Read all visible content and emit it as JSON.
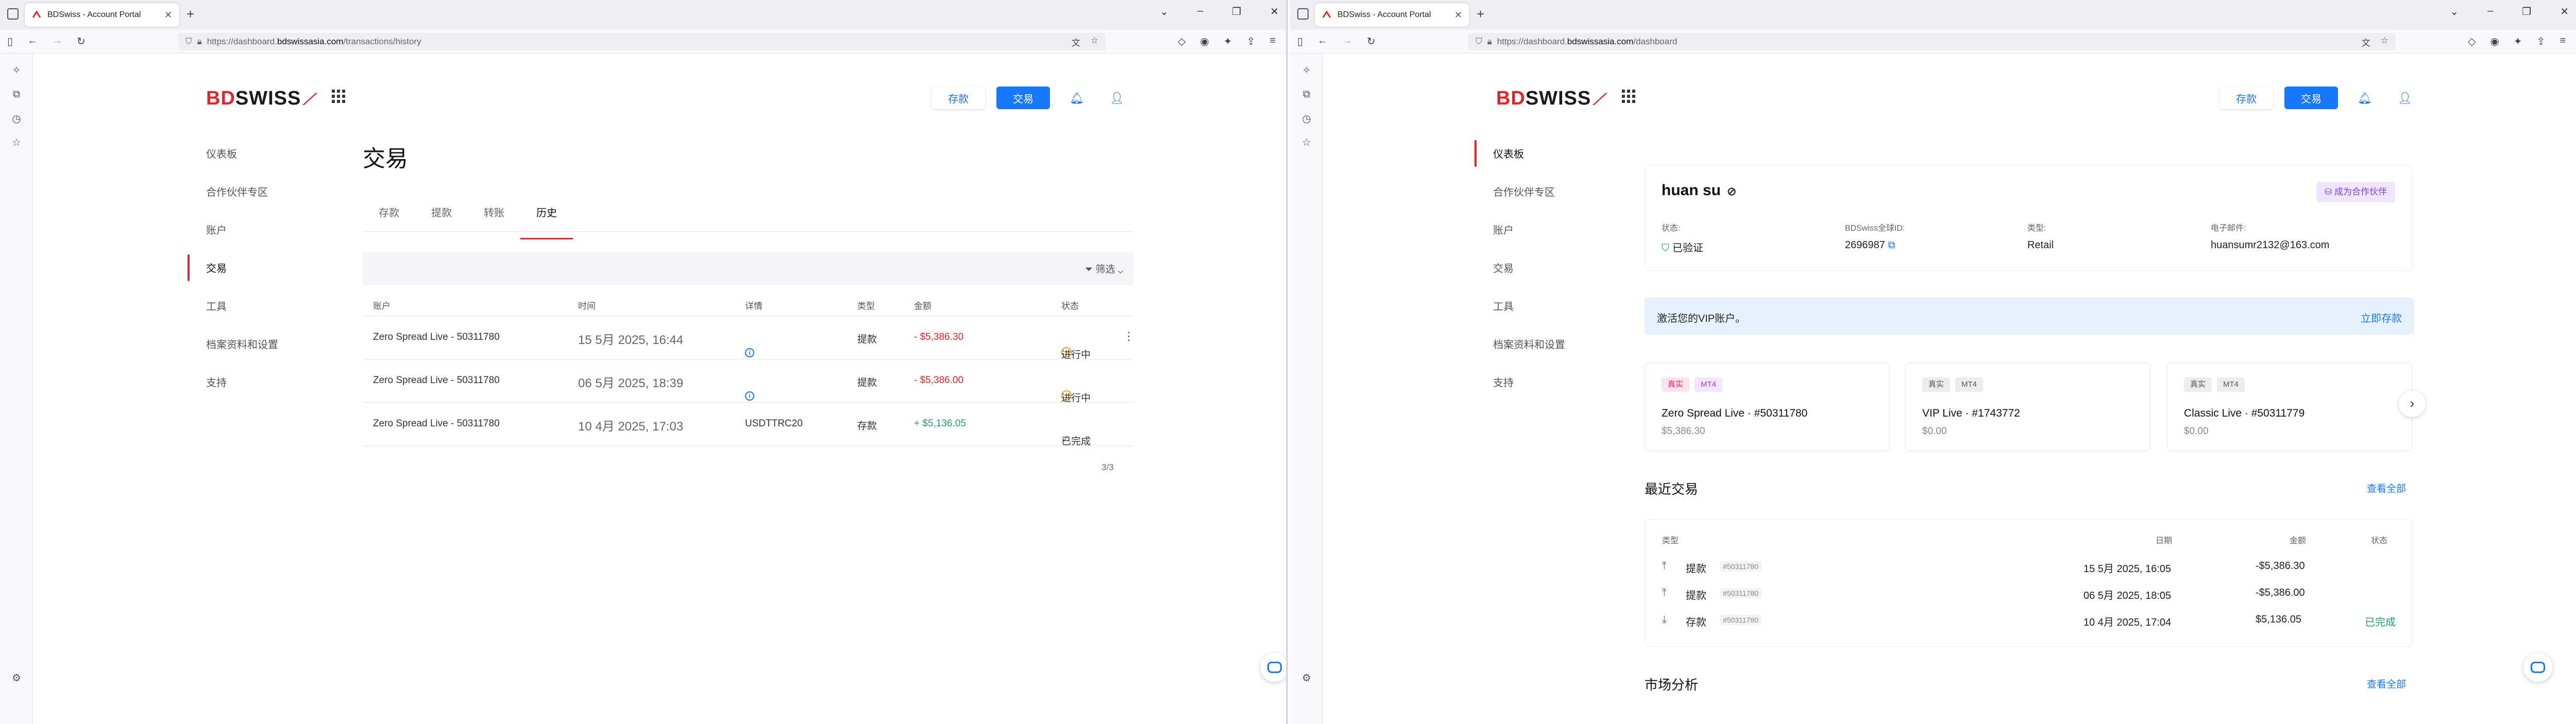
{
  "left_window": {
    "tab_title": "BDSwiss - Account Portal",
    "url_prefix": "https://dashboard.",
    "url_host": "bdswissasia.com",
    "url_path": "/transactions/history",
    "header": {
      "deposit": "存款",
      "trade": "交易"
    },
    "sidebar": [
      "仪表板",
      "合作伙伴专区",
      "账户",
      "交易",
      "工具",
      "档案资料和设置",
      "支持"
    ],
    "sidebar_active": "交易",
    "page_title": "交易",
    "tabs": [
      "存款",
      "提款",
      "转账",
      "历史"
    ],
    "active_tab": "历史",
    "filter_label": "筛选",
    "table": {
      "headers": [
        "账户",
        "时间",
        "详情",
        "类型",
        "金额",
        "状态"
      ],
      "rows": [
        {
          "account": "Zero Spread Live - 50311780",
          "time": "15 5月 2025, 16:44",
          "detail": "",
          "type": "提款",
          "amount": "- $5,386.30",
          "status": "进行中"
        },
        {
          "account": "Zero Spread Live - 50311780",
          "time": "06 5月 2025, 18:39",
          "detail": "",
          "type": "提款",
          "amount": "- $5,386.00",
          "status": "进行中"
        },
        {
          "account": "Zero Spread Live - 50311780",
          "time": "10 4月 2025, 17:03",
          "detail": "USDTTRC20",
          "type": "存款",
          "amount": "+ $5,136.05",
          "status": "已完成"
        }
      ]
    },
    "pagination": "3/3"
  },
  "right_window": {
    "tab_title": "BDSwiss - Account Portal",
    "url_prefix": "https://dashboard.",
    "url_host": "bdswissasia.com",
    "url_path": "/dashboard",
    "header": {
      "deposit": "存款",
      "trade": "交易"
    },
    "sidebar": [
      "仪表板",
      "合作伙伴专区",
      "账户",
      "交易",
      "工具",
      "档案资料和设置",
      "支持"
    ],
    "sidebar_active": "仪表板",
    "profile": {
      "name": "huan su",
      "become_partner": "成为合作伙伴",
      "status_label": "状态:",
      "status_value": "已验证",
      "id_label": "BDSwiss全球ID:",
      "id_value": "2696987",
      "type_label": "类型:",
      "type_value": "Retail",
      "email_label": "电子邮件:",
      "email_value": "huansumr2132@163.com"
    },
    "vip_banner": {
      "text": "激活您的VIP账户。",
      "link": "立即存款"
    },
    "accounts": [
      {
        "tag1": "真实",
        "tag2": "MT4",
        "name": "Zero Spread Live · #50311780",
        "balance": "$5,386.30"
      },
      {
        "tag1": "真实",
        "tag2": "MT4",
        "name": "VIP Live · #1743772",
        "balance": "$0.00"
      },
      {
        "tag1": "真实",
        "tag2": "MT4",
        "name": "Classic Live · #50311779",
        "balance": "$0.00"
      }
    ],
    "recent": {
      "title": "最近交易",
      "view_all": "查看全部",
      "headers": {
        "type": "类型",
        "date": "日期",
        "amount": "金额",
        "status": "状态"
      },
      "rows": [
        {
          "type": "提款",
          "account": "#50311780",
          "date": "15 5月 2025, 16:05",
          "amount": "-$5,386.30",
          "status": ""
        },
        {
          "type": "提款",
          "account": "#50311780",
          "date": "06 5月 2025, 18:05",
          "amount": "-$5,386.00",
          "status": ""
        },
        {
          "type": "存款",
          "account": "#50311780",
          "date": "10 4月 2025, 17:04",
          "amount": "$5,136.05",
          "status": "已完成"
        }
      ]
    },
    "market": {
      "title": "市场分析",
      "view_all": "查看全部"
    }
  },
  "colors": {
    "brand_red": "#e52329",
    "primary_blue": "#1677ff",
    "success_green": "#22a06b",
    "pending_orange": "#f0a020"
  },
  "logo_text": {
    "bd": "BD",
    "swiss": "SWISS"
  }
}
